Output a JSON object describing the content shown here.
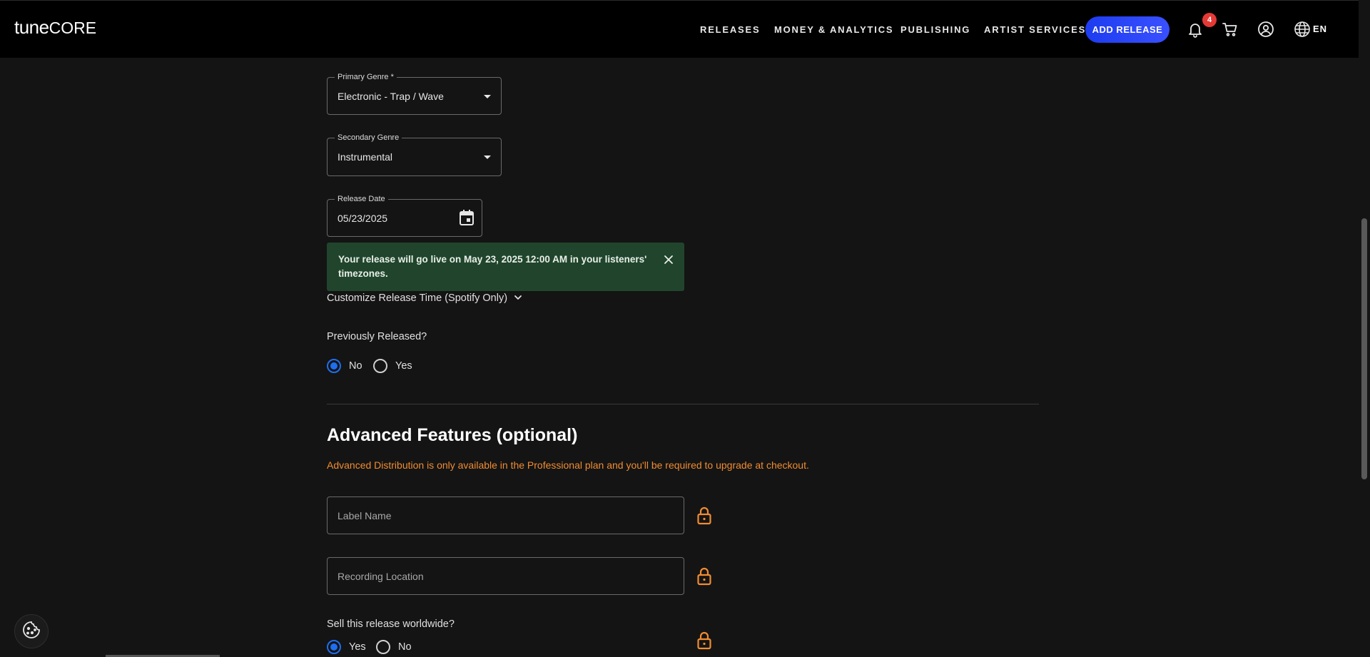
{
  "header": {
    "logo_tune": "tune",
    "logo_core": "CORE",
    "nav": [
      "RELEASES",
      "MONEY & ANALYTICS",
      "PUBLISHING",
      "ARTIST SERVICES"
    ],
    "add_release": "ADD RELEASE",
    "notification_count": "4",
    "language": "EN",
    "accent_color": "#2a45f5"
  },
  "form": {
    "primary_genre": {
      "label": "Primary Genre *",
      "value": "Electronic - Trap / Wave"
    },
    "secondary_genre": {
      "label": "Secondary Genre",
      "value": "Instrumental"
    },
    "release_date": {
      "label": "Release Date",
      "value": "05/23/2025"
    },
    "alert": {
      "text": "Your release will go live on May 23, 2025 12:00 AM in your listeners' timezones."
    },
    "customize_time": "Customize Release Time (Spotify Only)",
    "previously_released": {
      "question": "Previously Released?",
      "options": [
        "No",
        "Yes"
      ],
      "selected": "No"
    }
  },
  "advanced": {
    "title": "Advanced Features (optional)",
    "notice": "Advanced Distribution is only available in the Professional plan and you'll be required to upgrade at checkout.",
    "notice_color": "#f08c32",
    "label_name_placeholder": "Label Name",
    "recording_location_placeholder": "Recording Location",
    "sell_worldwide": {
      "question": "Sell this release worldwide?",
      "options": [
        "Yes",
        "No"
      ],
      "selected": "Yes"
    }
  }
}
